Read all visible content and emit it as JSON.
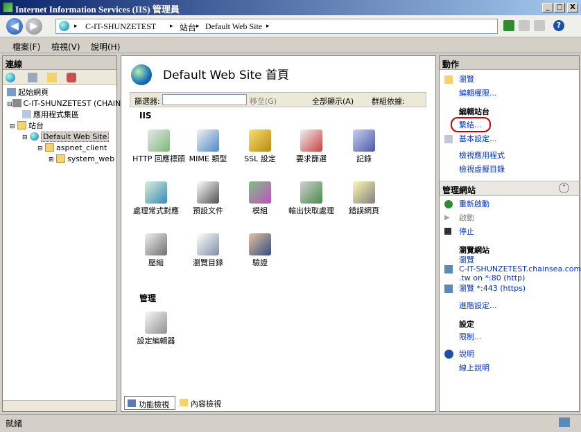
{
  "window": {
    "title": "Internet Information Services (IIS) 管理員",
    "min_label": "_",
    "max_label": "□",
    "close_label": "X"
  },
  "nav": {
    "back_label": "◀",
    "forward_label": "▶",
    "breadcrumb": [
      "C-IT-SHUNZETEST",
      "站台",
      "Default Web Site"
    ],
    "sep": "▸"
  },
  "menu": [
    "檔案(F)",
    "檢視(V)",
    "說明(H)"
  ],
  "connections": {
    "title": "連線",
    "tree": [
      {
        "label": "起始網頁",
        "indent": 0
      },
      {
        "label": "C-IT-SHUNZETEST (CHAIN",
        "indent": 0
      },
      {
        "label": "應用程式集區",
        "indent": 1
      },
      {
        "label": "站台",
        "indent": 1
      },
      {
        "label": "Default Web Site",
        "indent": 2
      },
      {
        "label": "aspnet_client",
        "indent": 3
      },
      {
        "label": "system_web",
        "indent": 4
      }
    ]
  },
  "main": {
    "title": "Default Web Site 首頁",
    "filter": {
      "label": "篩選器:",
      "go": "移至(G)",
      "show_all": "全部顯示(A)",
      "group_by": "群組依據:"
    },
    "section_iis": "IIS",
    "section_mgmt": "管理",
    "features": [
      "HTTP 回應標頭",
      "MIME 類型",
      "SSL 設定",
      "要求篩選",
      "記錄",
      "處理常式對應",
      "預設文件",
      "模組",
      "輸出快取處理",
      "錯誤網頁",
      "壓縮",
      "瀏覽目錄",
      "驗證"
    ],
    "mgmt_features": [
      "設定編輯器"
    ],
    "tabs": {
      "features_view": "功能檢視",
      "content_view": "內容檢視"
    }
  },
  "actions": {
    "title": "動作",
    "browse": "瀏覽",
    "edit_permissions": "編輯權限...",
    "edit_site_header": "編輯站台",
    "bindings": "繫結...",
    "basic_settings": "基本設定...",
    "view_apps": "檢視應用程式",
    "view_vdirs": "檢視虛擬目錄",
    "manage_site_header": "管理網站",
    "restart": "重新啟動",
    "start": "啟動",
    "stop": "停止",
    "browse_site_header": "瀏覽網站",
    "browse_http_1": "瀏覽",
    "browse_http_2": "C-IT-SHUNZETEST.chainsea.com",
    "browse_http_3": ".tw on *:80 (http)",
    "browse_https": "瀏覽 *:443 (https)",
    "advanced": "進階設定...",
    "config_header": "設定",
    "limits": "限制...",
    "help": "說明",
    "online_help": "線上說明"
  },
  "status": {
    "text": "就緒"
  },
  "colors": {
    "accent_link": "#0033cc",
    "highlight": "#cc0000",
    "title_bar": "#0a246a"
  }
}
